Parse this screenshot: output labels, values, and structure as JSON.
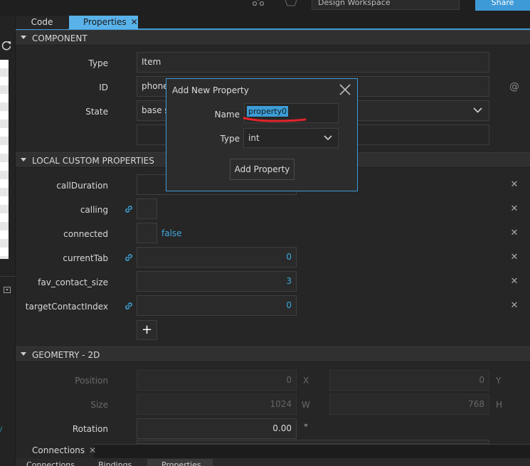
{
  "top": {
    "workspace_select": "Design Workspace",
    "share_button": "Share"
  },
  "tabs": [
    {
      "label": "Code"
    },
    {
      "label": "Properties",
      "close": "✕"
    }
  ],
  "component": {
    "section_title": "COMPONENT",
    "type_label": "Type",
    "type_value": "Item",
    "id_label": "ID",
    "id_value": "phone",
    "id_at_symbol": "@",
    "state_label": "State",
    "state_value": "base st"
  },
  "custom_props": {
    "section_title": "LOCAL CUSTOM PROPERTIES",
    "rows": [
      {
        "label": "callDuration"
      },
      {
        "label": "calling"
      },
      {
        "label": "connected",
        "value": "false"
      },
      {
        "label": "currentTab",
        "value": "0"
      },
      {
        "label": "fav_contact_size",
        "value": "3"
      },
      {
        "label": "targetContactIndex",
        "value": "0"
      }
    ],
    "add_button": "+"
  },
  "geometry": {
    "section_title": "GEOMETRY - 2D",
    "position_label": "Position",
    "position_x": "0",
    "x_unit": "X",
    "position_y": "0",
    "y_unit": "Y",
    "size_label": "Size",
    "size_w": "1024",
    "w_unit": "W",
    "size_h": "768",
    "h_unit": "H",
    "rotation_label": "Rotation",
    "rotation_value": "0.00",
    "rotation_unit": "°"
  },
  "dialog": {
    "title": "Add New Property",
    "name_label": "Name",
    "name_value": "property0",
    "type_label": "Type",
    "type_value": "int",
    "add_button": "Add Property"
  },
  "bottom": {
    "tab_connections": "Connections",
    "tab_close": "✕",
    "subtabs": [
      "Connections",
      "Bindings",
      "Properties"
    ]
  }
}
